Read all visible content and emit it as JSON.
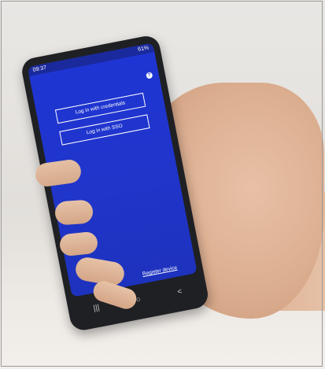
{
  "status_bar": {
    "time": "09:37",
    "battery": "61%"
  },
  "screen": {
    "help_symbol": "?",
    "login_credentials_label": "Log in with credentials",
    "login_sso_label": "Log in with SSO",
    "register_label": "Register device"
  },
  "nav": {
    "recent_symbol": "|||",
    "home_symbol": "○",
    "back_symbol": "<"
  },
  "colors": {
    "screen_blue": "#1f35d4",
    "phone_case": "#1f2023",
    "skin": "#e0b597",
    "background": "#e6e3df"
  }
}
